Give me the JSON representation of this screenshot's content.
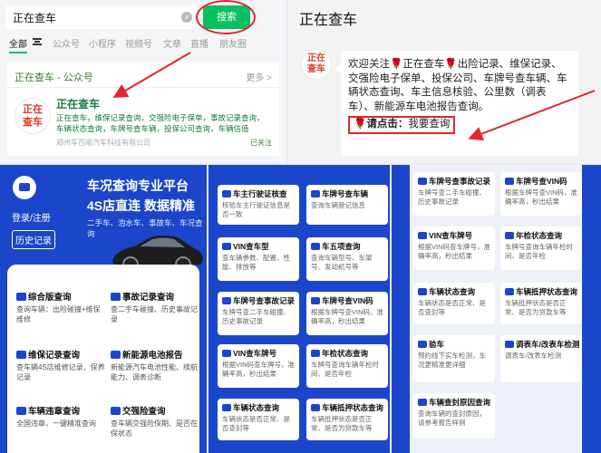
{
  "search": {
    "query": "正在查车",
    "clear_symbol": "×",
    "button_label": "搜索"
  },
  "tabs": [
    "全部",
    "公众号",
    "小程序",
    "视频号",
    "文章",
    "直播",
    "朋友圈"
  ],
  "account_card": {
    "header": "正在查车 - 公众号",
    "more": "更多 >",
    "logo_line1": "正在",
    "logo_line2": "查车",
    "name": "正在查车",
    "desc_line1": "正在查车，维保记录查询，交强险电子保单，事故记录查询，",
    "desc_line2": "车辆状态查询，车牌号查车辆，投保公司查询，车辆估值",
    "corp": "郑州车百顺汽车科技有限公司",
    "follow": "已关注"
  },
  "chat": {
    "title": "正在查车",
    "logo_line1": "正在",
    "logo_line2": "查车",
    "message": "欢迎关注🌹正在查车🌹出险记录、维保记录、交强险电子保单、投保公司、车牌号查车辆、车辆状态查询、车主信息核验、公里数（调表车）、新能源车电池报告查询。",
    "click_label": "🌹请点击：",
    "click_value": "我要查询"
  },
  "bottom_left": {
    "login": "登录/注册",
    "history": "历史记录",
    "title_line1": "车况查询专业平台",
    "title_line2": "4S店直连 数据精准",
    "subtitle": "二手车、泡水车、事故车、车况查询",
    "services": [
      {
        "title": "综合版查询",
        "desc": "查询车辆：出险碰撞+维保维修"
      },
      {
        "title": "事故记录查询",
        "desc": "查二手车碰撞、历史事故记录"
      },
      {
        "title": "维保记录查询",
        "desc": "查车辆4S店维修记录、保养记录"
      },
      {
        "title": "新能源电池报告",
        "desc": "新能源汽车电池性能、续航能力、调表诊断"
      },
      {
        "title": "车辆违章查询",
        "desc": "全国违章，一键精准查询"
      },
      {
        "title": "交强险查询",
        "desc": "查车辆交强险保期、是否在保状态"
      }
    ]
  },
  "bottom_mid": {
    "cards": [
      {
        "title": "车主行驶证核查",
        "desc": "核验车主行驶证信息是否一致"
      },
      {
        "title": "车牌号查车辆",
        "desc": "查询车辆登记信息"
      },
      {
        "title": "VIN查车型",
        "desc": "查车辆参数、配置、性能、排放等"
      },
      {
        "title": "车五项查询",
        "desc": "查询车辆型号、车架号、发动机号等"
      },
      {
        "title": "车牌号查事故记录",
        "desc": "车牌号查二手车碰撞、历史事故记录"
      },
      {
        "title": "车牌号查VIN码",
        "desc": "根据车牌号查VIN码，准确率高，秒出结果"
      },
      {
        "title": "VIN查车牌号",
        "desc": "根据VIN码查车牌号，准确率高，秒出结果"
      },
      {
        "title": "年检状态查询",
        "desc": "车牌号查询车辆年检时间、是否年检"
      },
      {
        "title": "车辆状态查询",
        "desc": "车辆状态是否正常、是否查封等"
      },
      {
        "title": "车辆抵押状态查询",
        "desc": "车辆抵押状态是否正常、是否为贷款车等"
      }
    ]
  },
  "bottom_right": {
    "cards": [
      {
        "title": "车牌号查事故记录",
        "desc": "车牌号查二手车碰撞、历史事故记录"
      },
      {
        "title": "车牌号查VIN码",
        "desc": "根据车牌号查VIN码，准确率高，秒出结果"
      },
      {
        "title": "VIN查车牌号",
        "desc": "根据VIN码查车牌号，准确率高，秒出结果"
      },
      {
        "title": "年检状态查询",
        "desc": "车牌号查询车辆年检时间、是否年检"
      },
      {
        "title": "车辆状态查询",
        "desc": "车辆状态是否正常、是否查封等"
      },
      {
        "title": "车辆抵押状态查询",
        "desc": "车辆抵押状态是否正常、是否为贷款车等"
      },
      {
        "title": "验车",
        "desc": "预约线下实车检测，车况更精准更详细"
      },
      {
        "title": "调表车/改表车检测",
        "desc": "调表车/改表车检测"
      },
      {
        "title": "车辆查封原因查询",
        "desc": "查询车辆的查封原因，请参考报告样例"
      }
    ]
  },
  "colors": {
    "wechat_green": "#07c160",
    "annotation_red": "#e0262f",
    "brand_blue": "#1b46c9"
  }
}
